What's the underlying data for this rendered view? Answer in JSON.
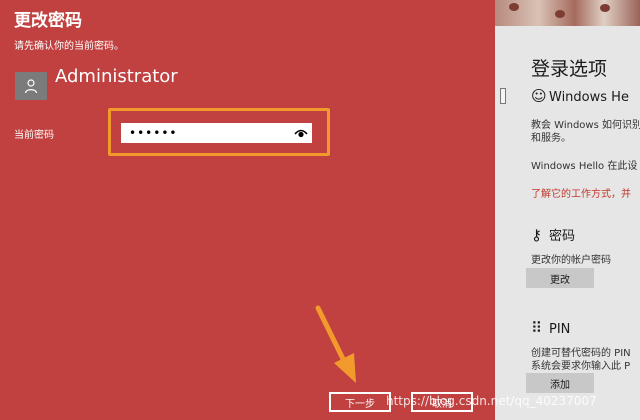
{
  "dialog": {
    "title": "更改密码",
    "subtitle": "请先确认你的当前密码。",
    "username": "Administrator",
    "password_label": "当前密码",
    "password_value": "••••••",
    "next_label": "下一步",
    "cancel_label": "取消"
  },
  "background_settings": {
    "title": "登录选项",
    "hello_heading": "Windows He",
    "hello_desc_line1": "教会 Windows 如何识别",
    "hello_desc_line2": "和服务。",
    "hello_text": "Windows Hello 在此设",
    "hello_link": "了解它的工作方式，并",
    "password_heading": "密码",
    "password_desc": "更改你的帐户密码",
    "change_button": "更改",
    "pin_heading": "PIN",
    "pin_desc_line1": "创建可替代密码的 PIN",
    "pin_desc_line2": "系统会要求你输入此 P",
    "add_button": "添加"
  },
  "watermark": "https://blog.csdn.net/qq_40237007",
  "colors": {
    "dialog_bg": "#c0413f",
    "highlight": "#f39a2c",
    "arrow": "#f39a2c",
    "settings_bg": "#e6e6e6",
    "link_red": "#c0392b"
  },
  "icons": {
    "avatar": "person-icon",
    "eye": "eye-icon",
    "hello": "smiley-icon",
    "password": "key-icon",
    "pin": "keypad-icon",
    "arrow": "arrow-annotation"
  }
}
